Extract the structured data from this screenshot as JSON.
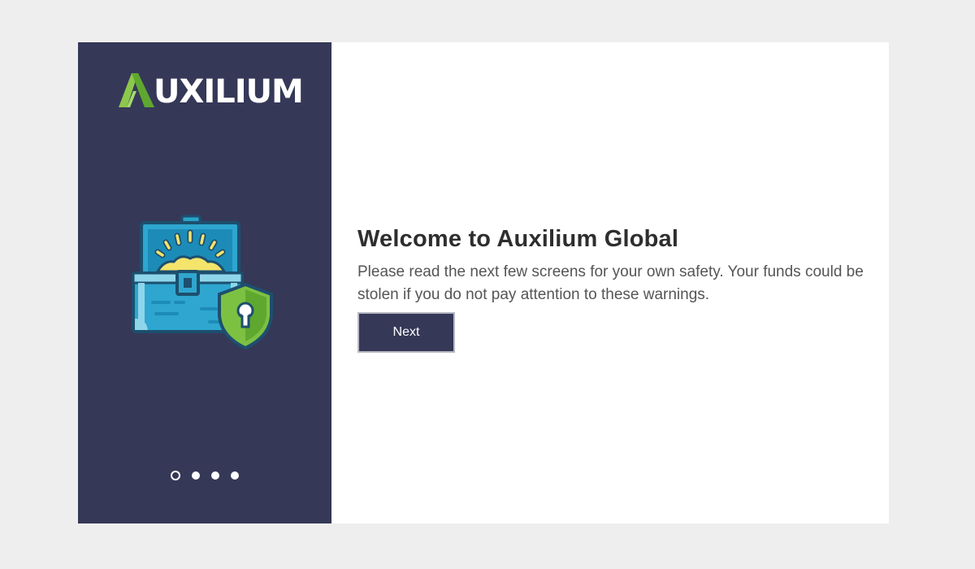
{
  "brand": {
    "logo_text": "UXILIUM",
    "logo_mark_icon": "stylized-a-logo-icon",
    "accent_color": "#7dc142",
    "panel_color": "#363858"
  },
  "sidebar": {
    "illustration_icon": "treasure-chest-shield-lock-icon",
    "pagination": {
      "total": 4,
      "current": 1
    }
  },
  "main": {
    "title": "Welcome to Auxilium Global",
    "description": "Please read the next few screens for your own safety. Your funds could be stolen if you do not pay attention to these warnings.",
    "next_label": "Next"
  }
}
